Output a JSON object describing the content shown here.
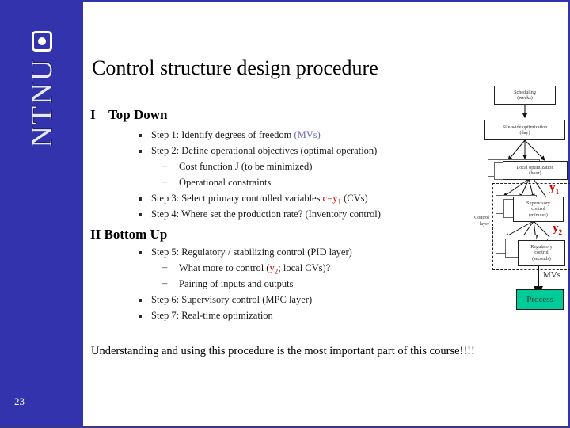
{
  "slide": {
    "title": "Control structure design procedure",
    "page_number": "23",
    "logo_text": "NTNU",
    "closing_line": "Understanding and using this procedure is the most important part of this course!!!!"
  },
  "sections": [
    {
      "numeral": "I",
      "heading": "Top Down",
      "items": [
        {
          "level": 1,
          "text_before": "Step 1: Identify degrees of freedom ",
          "highlight": "(MVs)",
          "highlight_color": "#6b6bb0",
          "text_after": ""
        },
        {
          "level": 1,
          "text_before": "Step 2: Define operational objectives (optimal operation)",
          "highlight": "",
          "text_after": ""
        },
        {
          "level": 2,
          "text_before": "Cost function J (to be minimized)",
          "highlight": "",
          "text_after": ""
        },
        {
          "level": 2,
          "text_before": "Operational constraints",
          "highlight": "",
          "text_after": ""
        },
        {
          "level": 1,
          "text_before": "Step 3: Select primary controlled variables ",
          "highlight": "c=y1",
          "highlight_color": "#cc0000",
          "text_after": " (CVs)"
        },
        {
          "level": 1,
          "text_before": "Step 4: Where set the production rate? (Inventory control)",
          "highlight": "",
          "text_after": ""
        }
      ]
    },
    {
      "numeral": "II",
      "heading": "Bottom Up",
      "items": [
        {
          "level": 1,
          "text_before": "Step 5: Regulatory / stabilizing control (PID layer)",
          "highlight": "",
          "text_after": ""
        },
        {
          "level": 2,
          "text_before": "What more to control (",
          "highlight": "y2",
          "highlight_color": "#cc0000",
          "text_after": "; local CVs)?"
        },
        {
          "level": 2,
          "text_before": "Pairing of inputs and outputs",
          "highlight": "",
          "text_after": ""
        },
        {
          "level": 1,
          "text_before": "Step 6: Supervisory control (MPC layer)",
          "highlight": "",
          "text_after": ""
        },
        {
          "level": 1,
          "text_before": "Step 7: Real-time optimization",
          "highlight": "",
          "text_after": ""
        }
      ]
    }
  ],
  "diagram": {
    "boxes": [
      {
        "name": "Scheduling",
        "time": "(weeks)"
      },
      {
        "name": "Site-wide optimization",
        "time": "(day)"
      },
      {
        "name": "Local optimization",
        "time": "(hour)"
      },
      {
        "name": "Supervisory",
        "time2": "control",
        "time": "(minutes)"
      },
      {
        "name": "Regulatory",
        "time2": "control",
        "time": "(seconds)"
      }
    ],
    "layer_label_line1": "Control",
    "layer_label_line2": "layer",
    "y1_label": "y",
    "y1_sub": "1",
    "y2_label": "y",
    "y2_sub": "2",
    "mvs_label": "MVs",
    "process_label": "Process",
    "process_color": "#00cc99"
  },
  "colors": {
    "brand_blue": "#3333ad",
    "accent_red": "#cc0000",
    "mv_blue": "#6b6bb0",
    "process_green": "#00cc99"
  }
}
